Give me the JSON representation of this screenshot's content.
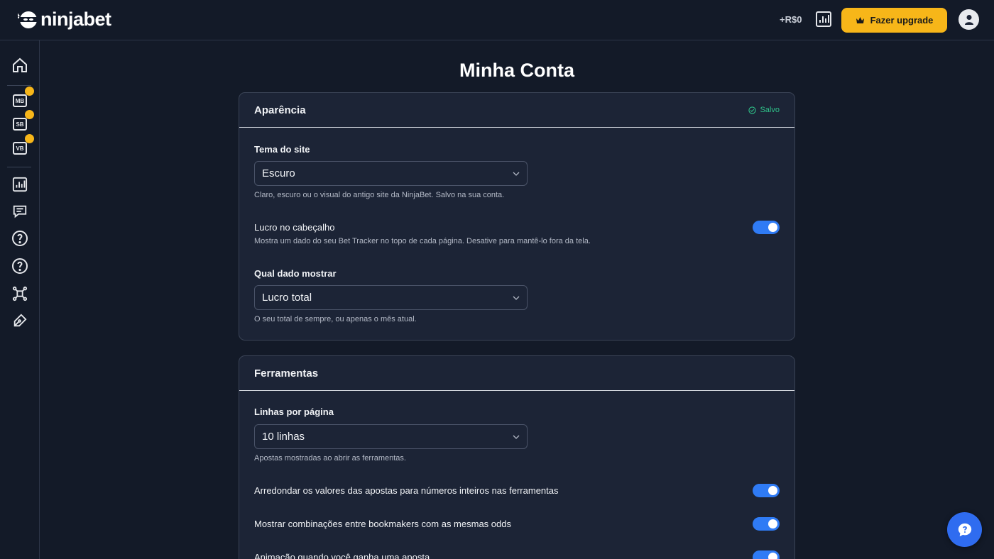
{
  "header": {
    "logo_text": "ninjabet",
    "profit": "+R$0",
    "upgrade_label": "Fazer upgrade"
  },
  "sidebar": {
    "items": [
      {
        "name": "home-icon"
      },
      {
        "name": "mb-icon",
        "text": "MB"
      },
      {
        "name": "sb-icon",
        "text": "SB"
      },
      {
        "name": "vb-icon",
        "text": "VB"
      },
      {
        "name": "chart-icon"
      },
      {
        "name": "chat-icon"
      },
      {
        "name": "help-icon"
      },
      {
        "name": "help-icon-2"
      },
      {
        "name": "network-icon"
      },
      {
        "name": "pen-icon"
      }
    ]
  },
  "page": {
    "title": "Minha Conta"
  },
  "appearance": {
    "title": "Aparência",
    "saved": "Salvo",
    "theme_label": "Tema do site",
    "theme_value": "Escuro",
    "theme_help": "Claro, escuro ou o visual do antigo site da NinjaBet. Salvo na sua conta.",
    "profit_header_label": "Lucro no cabeçalho",
    "profit_header_help": "Mostra um dado do seu Bet Tracker no topo de cada página. Desative para mantê-lo fora da tela.",
    "profit_header_on": true,
    "which_label": "Qual dado mostrar",
    "which_value": "Lucro total",
    "which_help": "O seu total de sempre, ou apenas o mês atual."
  },
  "tools": {
    "title": "Ferramentas",
    "rows_label": "Linhas por página",
    "rows_value": "10 linhas",
    "rows_help": "Apostas mostradas ao abrir as ferramentas.",
    "round_label": "Arredondar os valores das apostas para números inteiros nas ferramentas",
    "round_on": true,
    "combos_label": "Mostrar combinações entre bookmakers com as mesmas odds",
    "combos_on": true,
    "animation_label": "Animação quando você ganha uma aposta",
    "animation_on": true
  },
  "colors": {
    "background": "#131a28",
    "card": "#1c2436",
    "accent": "#f7b619",
    "toggle": "#2f7bf5",
    "saved": "#2fc28a"
  }
}
